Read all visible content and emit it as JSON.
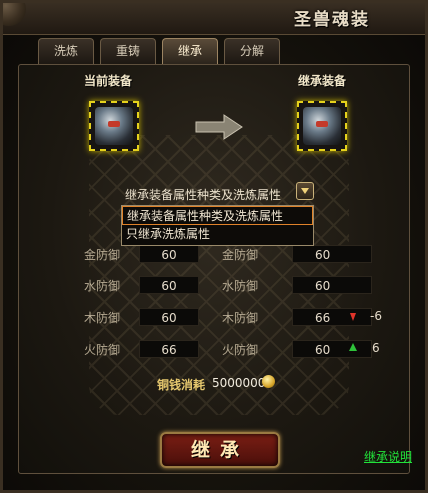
{
  "window": {
    "title": "圣兽魂装"
  },
  "tabs": [
    {
      "label": "洗炼",
      "active": false
    },
    {
      "label": "重铸",
      "active": false
    },
    {
      "label": "继承",
      "active": true
    },
    {
      "label": "分解",
      "active": false
    }
  ],
  "current_equip": {
    "label": "当前装备",
    "item_icon": "beast-armor-icon"
  },
  "inherit_equip": {
    "label": "继承装备",
    "item_icon": "beast-armor-icon"
  },
  "inherit_mode": {
    "selected": "继承装备属性种类及洗炼属性",
    "options": [
      "继承装备属性种类及洗炼属性",
      "只继承洗炼属性"
    ]
  },
  "stats": [
    {
      "left_label": "金防御",
      "left_value": "60",
      "right_label": "金防御",
      "right_value": "60",
      "diff": "",
      "trend": ""
    },
    {
      "left_label": "水防御",
      "left_value": "60",
      "right_label": "水防御",
      "right_value": "60",
      "diff": "",
      "trend": ""
    },
    {
      "left_label": "木防御",
      "left_value": "60",
      "right_label": "木防御",
      "right_value": "66",
      "diff": "-6",
      "trend": "down"
    },
    {
      "left_label": "火防御",
      "left_value": "66",
      "right_label": "火防御",
      "right_value": "60",
      "diff": "6",
      "trend": "up"
    }
  ],
  "cost": {
    "label": "铜钱消耗",
    "value": "5000000",
    "icon": "copper-coin-icon"
  },
  "actions": {
    "inherit_button": "继承",
    "help_link": "继承说明"
  },
  "colors": {
    "accent_gold": "#e6d21c",
    "down_red": "#e0342a",
    "up_green": "#2ec23a",
    "link_green": "#22e23a"
  }
}
